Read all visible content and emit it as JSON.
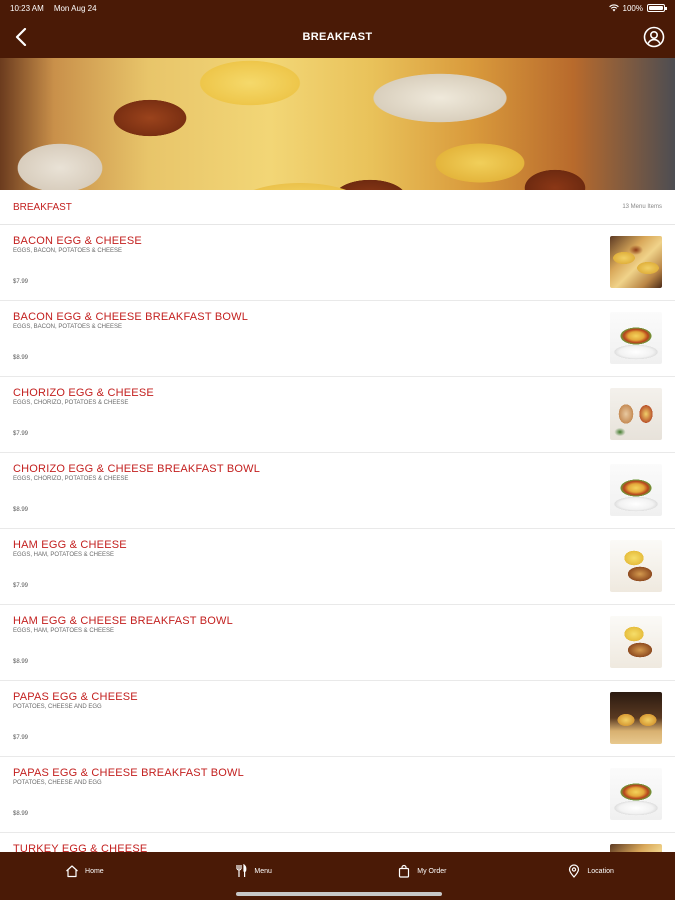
{
  "status_bar": {
    "time": "10:23 AM",
    "date": "Mon Aug 24",
    "battery": "100%",
    "battery_level": 1.0
  },
  "nav": {
    "title": "BREAKFAST"
  },
  "section": {
    "title": "BREAKFAST",
    "count": "13 Menu Items"
  },
  "items": [
    {
      "name": "BACON EGG & CHEESE",
      "desc": "EGGS, BACON, POTATOES & CHEESE",
      "price": "$7.99",
      "thumb": "burrito"
    },
    {
      "name": "BACON EGG & CHEESE BREAKFAST BOWL",
      "desc": "EGGS, BACON, POTATOES & CHEESE",
      "price": "$8.99",
      "thumb": "bowl"
    },
    {
      "name": "CHORIZO EGG & CHEESE",
      "desc": "EGGS, CHORIZO, POTATOES & CHEESE",
      "price": "$7.99",
      "thumb": "wrap"
    },
    {
      "name": "CHORIZO EGG & CHEESE BREAKFAST BOWL",
      "desc": "EGGS, CHORIZO, POTATOES & CHEESE",
      "price": "$8.99",
      "thumb": "bowl"
    },
    {
      "name": "HAM EGG & CHEESE",
      "desc": "EGGS, HAM, POTATOES & CHEESE",
      "price": "$7.99",
      "thumb": "hand"
    },
    {
      "name": "HAM EGG & CHEESE BREAKFAST BOWL",
      "desc": "EGGS, HAM, POTATOES & CHEESE",
      "price": "$8.99",
      "thumb": "hand"
    },
    {
      "name": "PAPAS EGG & CHEESE",
      "desc": "POTATOES, CHEESE AND EGG",
      "price": "$7.99",
      "thumb": "dark"
    },
    {
      "name": "PAPAS EGG & CHEESE BREAKFAST BOWL",
      "desc": "POTATOES, CHEESE AND EGG",
      "price": "$8.99",
      "thumb": "bowl"
    },
    {
      "name": "TURKEY EGG & CHEESE",
      "desc": "",
      "price": "",
      "thumb": "burrito"
    }
  ],
  "tabs": [
    {
      "label": "Home",
      "icon": "home-icon"
    },
    {
      "label": "Menu",
      "icon": "fork-knife-icon"
    },
    {
      "label": "My Order",
      "icon": "shopping-bag-icon"
    },
    {
      "label": "Location",
      "icon": "location-pin-icon"
    }
  ],
  "colors": {
    "brand": "#4a1a06",
    "accent": "#c3201f"
  }
}
